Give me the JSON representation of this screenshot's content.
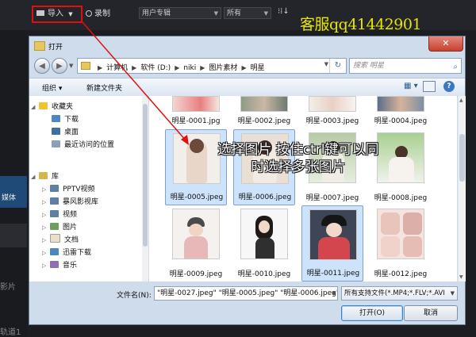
{
  "app": {
    "import_label": "导入",
    "record_label": "录制",
    "category_select": "用户专辑",
    "filter_select": "所有",
    "watermark": "客服qq41442901",
    "side_label_1": "媒体",
    "side_label_2": "影片",
    "side_label_3": "轨道1"
  },
  "dialog": {
    "title": "打开",
    "close": "✕",
    "breadcrumbs": [
      "计算机",
      "软件 (D:)",
      "niki",
      "图片素材",
      "明星"
    ],
    "search_placeholder": "搜索 明星",
    "toolbar": {
      "organize": "组织 ▾",
      "new_folder": "新建文件夹"
    },
    "nav": {
      "favorites": "收藏夹",
      "downloads": "下载",
      "desktop": "桌面",
      "recent": "最近访问的位置",
      "libraries": "库",
      "pptv": "PPTV视频",
      "storm": "暴风影视库",
      "video": "视频",
      "pictures": "图片",
      "documents": "文档",
      "xunlei": "迅雷下载",
      "music": "音乐"
    },
    "files": [
      "明星-0001.jpg",
      "明星-0002.jpeg",
      "明星-0003.jpeg",
      "明星-0004.jpeg",
      "明星-0005.jpeg",
      "明星-0006.jpeg",
      "明星-0007.jpeg",
      "明星-0008.jpeg",
      "明星-0009.jpeg",
      "明星-0010.jpeg",
      "明星-0011.jpeg",
      "明星-0012.jpeg"
    ],
    "selected_files": [
      "明星-0005.jpeg",
      "明星-0006.jpeg",
      "明星-0011.jpeg"
    ],
    "filename_label": "文件名(N):",
    "filename_value": "\"明星-0027.jpeg\" \"明星-0005.jpeg\" \"明星-0006.jpeg\"",
    "filetype_value": "所有支持文件(*.MP4;*.FLV;*.AVI",
    "open_button": "打开(O)",
    "cancel_button": "取消"
  },
  "annotation": {
    "line1": "选择图片 按住ctrl键可以同",
    "line2": "时选择多张图片",
    "color": "#e01010"
  }
}
